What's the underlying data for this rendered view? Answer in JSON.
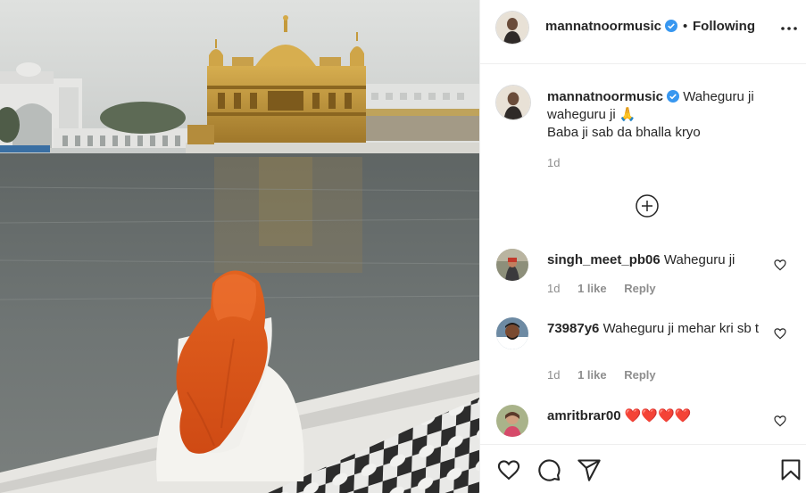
{
  "post": {
    "image_alt": "Person in orange scarf seated by the sarovar facing the Golden Temple",
    "colors": {
      "scarf": "#e0551c",
      "gold": "#c49a3c",
      "water": "#6e7473",
      "sky": "#d9dbd9"
    }
  },
  "header": {
    "username": "mannatnoormusic",
    "verified_icon": "verified-badge-icon",
    "separator": "•",
    "follow_status": "Following",
    "more_icon": "more-options-icon"
  },
  "caption": {
    "username": "mannatnoormusic",
    "text_line1": "Waheguru ji",
    "text_line2": "waheguru ji 🙏",
    "text_line3": "Baba ji sab da bhalla kryo",
    "time": "1d",
    "load_more_icon": "plus-circle-icon"
  },
  "comments": [
    {
      "username": "singh_meet_pb06",
      "text": "Waheguru ji",
      "time": "1d",
      "likes": "1 like",
      "reply": "Reply"
    },
    {
      "username": "73987y6",
      "text": "Waheguru ji mehar kri sb t",
      "time": "1d",
      "likes": "1 like",
      "reply": "Reply"
    },
    {
      "username": "amritbrar00",
      "text": "❤️❤️❤️❤️"
    }
  ],
  "actions": {
    "like_icon": "heart-icon",
    "comment_icon": "comment-icon",
    "share_icon": "share-icon",
    "save_icon": "bookmark-icon"
  },
  "accent": "#0095f6"
}
